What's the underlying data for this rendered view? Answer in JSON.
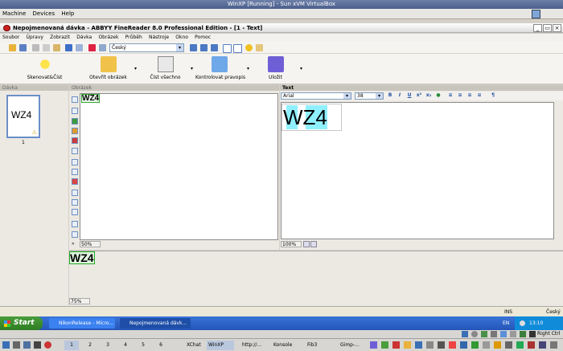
{
  "vbox": {
    "title": "WinXP [Running] - Sun xVM VirtualBox",
    "menu": [
      "Machine",
      "Devices",
      "Help"
    ]
  },
  "app": {
    "title": "Nepojmenovaná dávka - ABBYY FineReader 8.0 Professional Edition - [1 - Text]",
    "menu": [
      "Soubor",
      "Úpravy",
      "Zobrazit",
      "Dávka",
      "Obrázek",
      "Průběh",
      "Nástroje",
      "Okno",
      "Pomoc"
    ],
    "language": "Český",
    "big_buttons": [
      "Skenovat&Číst",
      "Otevřít obrázek",
      "Číst všechno",
      "Kontrolovat pravopis",
      "Uložit"
    ]
  },
  "panels": {
    "batch_label": "Dávka",
    "image_label": "Obrázek",
    "text_label": "Text",
    "thumb_text": "WZ4",
    "page_number": "1",
    "image_zoom": "50%",
    "text_zoom": "100%",
    "bottom_zoom": "75%",
    "font_name": "Arial",
    "font_size": "38",
    "document_text": "WZ4",
    "image_text": "WZ4"
  },
  "status": {
    "ins": "INS",
    "lang": "Český"
  },
  "taskbar": {
    "start": "Start",
    "tasks": [
      "NikonRelease - Micro...",
      "Nepojmenovaná dávk..."
    ],
    "lang": "EN",
    "time": "13:10"
  },
  "host": {
    "items": [
      "1",
      "2",
      "3",
      "4",
      "5",
      "6",
      "XChat",
      "WinXP",
      "http://...",
      "Konsole",
      "Fib3",
      "Gimp-..."
    ],
    "right_ctrl": "Right Ctrl"
  }
}
